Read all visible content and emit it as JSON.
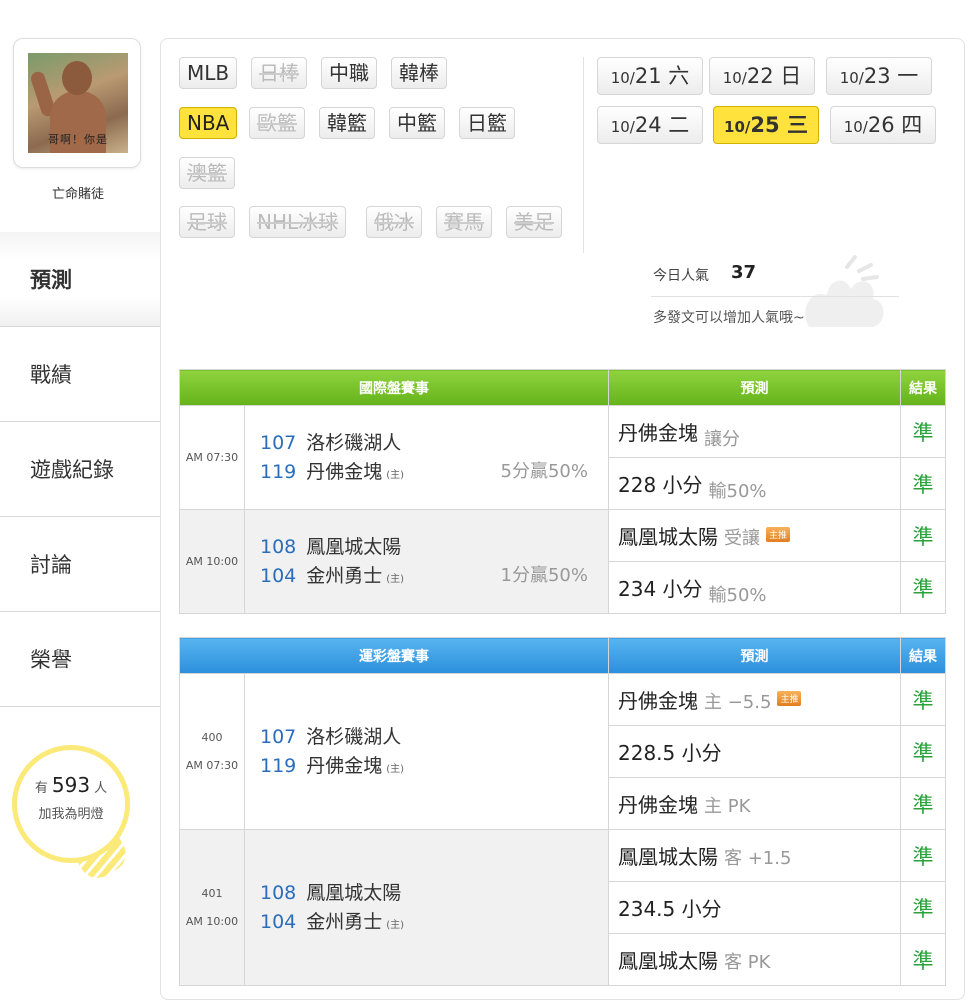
{
  "profile": {
    "avatar_caption": "哥啊！你是",
    "username": "亡命賭徒"
  },
  "nav": [
    {
      "label": "預測",
      "active": true
    },
    {
      "label": "戰績"
    },
    {
      "label": "遊戲紀錄"
    },
    {
      "label": "討論"
    },
    {
      "label": "榮譽"
    }
  ],
  "bulb": {
    "prefix": "有",
    "count": "593",
    "suffix": "人",
    "line2": "加我為明燈"
  },
  "categories": {
    "mlb": "MLB",
    "jp_baseball": "日棒",
    "cpbl": "中職",
    "kr_baseball": "韓棒",
    "nba": "NBA",
    "euro_bb": "歐籃",
    "kr_bb": "韓籃",
    "cn_bb": "中籃",
    "jp_bb": "日籃",
    "au_bb": "澳籃",
    "soccer": "足球",
    "nhl": "NHL冰球",
    "ru_ice": "俄冰",
    "horse": "賽馬",
    "us_football": "美足"
  },
  "dates": [
    {
      "month": "10/",
      "day": "21",
      "wd": "六"
    },
    {
      "month": "10/",
      "day": "22",
      "wd": "日"
    },
    {
      "month": "10/",
      "day": "23",
      "wd": "一"
    },
    {
      "month": "10/",
      "day": "24",
      "wd": "二"
    },
    {
      "month": "10/",
      "day": "25",
      "wd": "三",
      "selected": true
    },
    {
      "month": "10/",
      "day": "26",
      "wd": "四"
    }
  ],
  "popularity": {
    "label": "今日人氣",
    "value": "37",
    "tip": "多發文可以增加人氣哦~"
  },
  "intl_table": {
    "header": {
      "game": "國際盤賽事",
      "pred": "預測",
      "result": "結果"
    },
    "rows": [
      {
        "time": "AM 07:30",
        "team1_num": "107",
        "team1": "洛杉磯湖人",
        "team2_num": "119",
        "team2": "丹佛金塊",
        "host": "(主)",
        "spread": "5分贏50%",
        "preds": [
          {
            "main": "丹佛金塊",
            "sub": "讓分",
            "result": "準"
          },
          {
            "main": "228 小分",
            "sub": "輸50%",
            "result": "準"
          }
        ]
      },
      {
        "time": "AM 10:00",
        "team1_num": "108",
        "team1": "鳳凰城太陽",
        "team2_num": "104",
        "team2": "金州勇士",
        "host": "(主)",
        "spread": "1分贏50%",
        "preds": [
          {
            "main": "鳳凰城太陽",
            "sub": "受讓",
            "badge": "主推",
            "result": "準"
          },
          {
            "main": "234 小分",
            "sub": "輸50%",
            "result": "準"
          }
        ]
      }
    ]
  },
  "lottery_table": {
    "header": {
      "game": "運彩盤賽事",
      "pred": "預測",
      "result": "結果"
    },
    "rows": [
      {
        "code": "400",
        "time": "AM 07:30",
        "team1_num": "107",
        "team1": "洛杉磯湖人",
        "team2_num": "119",
        "team2": "丹佛金塊",
        "host": "(主)",
        "preds": [
          {
            "main": "丹佛金塊",
            "sub": "主 −5.5",
            "badge": "主推",
            "result": "準"
          },
          {
            "main": "228.5 小分",
            "sub": "",
            "result": "準"
          },
          {
            "main": "丹佛金塊",
            "sub": "主 PK",
            "result": "準"
          }
        ]
      },
      {
        "code": "401",
        "time": "AM 10:00",
        "team1_num": "108",
        "team1": "鳳凰城太陽",
        "team2_num": "104",
        "team2": "金州勇士",
        "host": "(主)",
        "preds": [
          {
            "main": "鳳凰城太陽",
            "sub": "客 +1.5",
            "result": "準"
          },
          {
            "main": "234.5 小分",
            "sub": "",
            "result": "準"
          },
          {
            "main": "鳳凰城太陽",
            "sub": "客 PK",
            "result": "準"
          }
        ]
      }
    ]
  }
}
